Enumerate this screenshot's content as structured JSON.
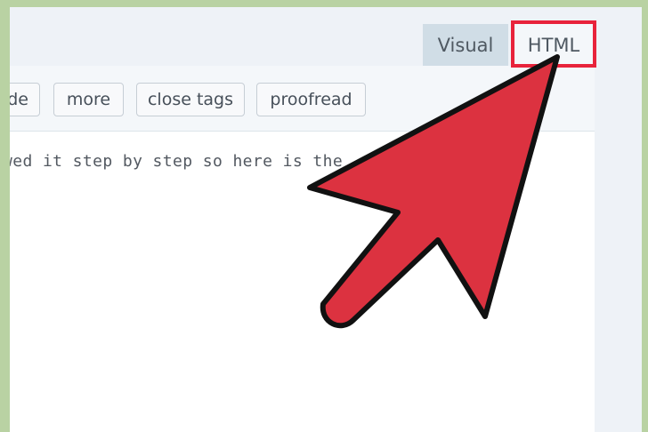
{
  "tabs": {
    "visual_label": "Visual",
    "html_label": "HTML"
  },
  "toolbar": {
    "code_label": "de",
    "more_label": "more",
    "close_tags_label": "close tags",
    "proofread_label": "proofread"
  },
  "editor": {
    "content_text": "wed it step by step so here is the          ed"
  },
  "colors": {
    "background_green": "#b9d2a3",
    "highlight_red": "#e8233b",
    "arrow_red": "#dc3240"
  }
}
